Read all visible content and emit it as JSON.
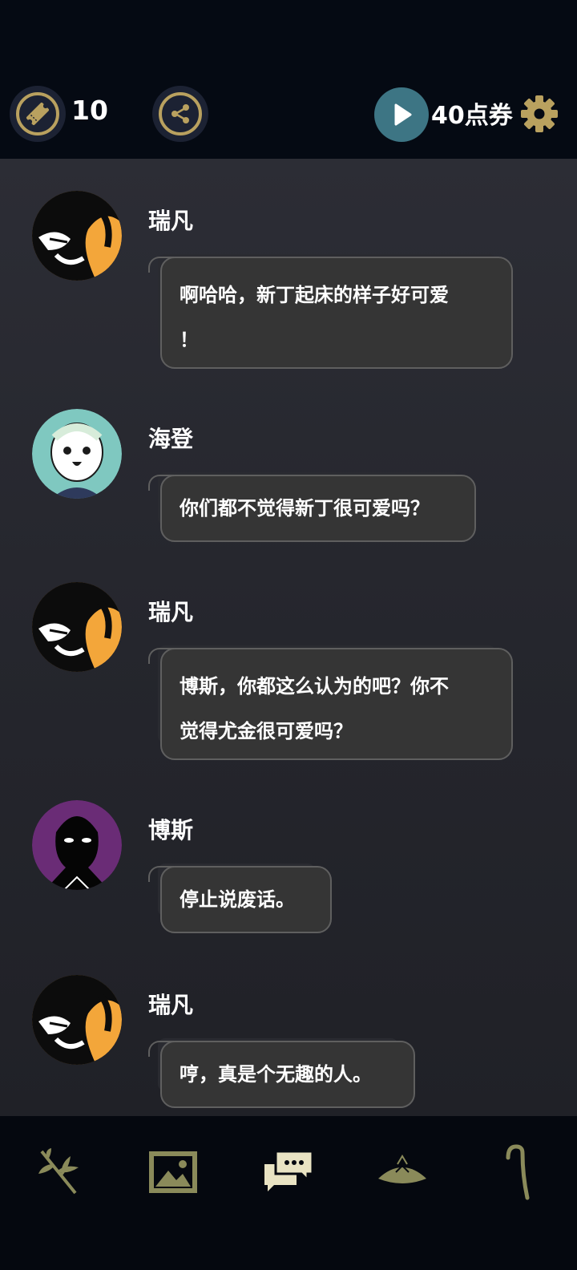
{
  "header": {
    "ticket_icon": "ticket-icon",
    "ticket_count": "10",
    "share_icon": "share-icon",
    "play_icon": "play-icon",
    "points_label": "40点券",
    "settings_icon": "gear-icon",
    "accent_color": "#b9a15f",
    "play_color": "#3d7584"
  },
  "messages": [
    {
      "speaker": "瑞凡",
      "avatar": "rufan-avatar",
      "lines": [
        "啊哈哈，新丁起床的样子好可爱",
        "！"
      ]
    },
    {
      "speaker": "海登",
      "avatar": "hayden-avatar",
      "lines": [
        "你们都不觉得新丁很可爱吗？"
      ]
    },
    {
      "speaker": "瑞凡",
      "avatar": "rufan-avatar",
      "lines": [
        "博斯，你都这么认为的吧？你不",
        "觉得尤金很可爱吗？"
      ]
    },
    {
      "speaker": "博斯",
      "avatar": "boss-avatar",
      "lines": [
        "停止说废话。"
      ]
    },
    {
      "speaker": "瑞凡",
      "avatar": "rufan-avatar",
      "lines": [
        "哼，真是个无趣的人。"
      ]
    }
  ],
  "bottom_nav": [
    {
      "icon": "branch-icon",
      "active": false
    },
    {
      "icon": "gallery-icon",
      "active": false
    },
    {
      "icon": "chat-icon",
      "active": true
    },
    {
      "icon": "hat-icon",
      "active": false
    },
    {
      "icon": "cane-icon",
      "active": false
    }
  ]
}
